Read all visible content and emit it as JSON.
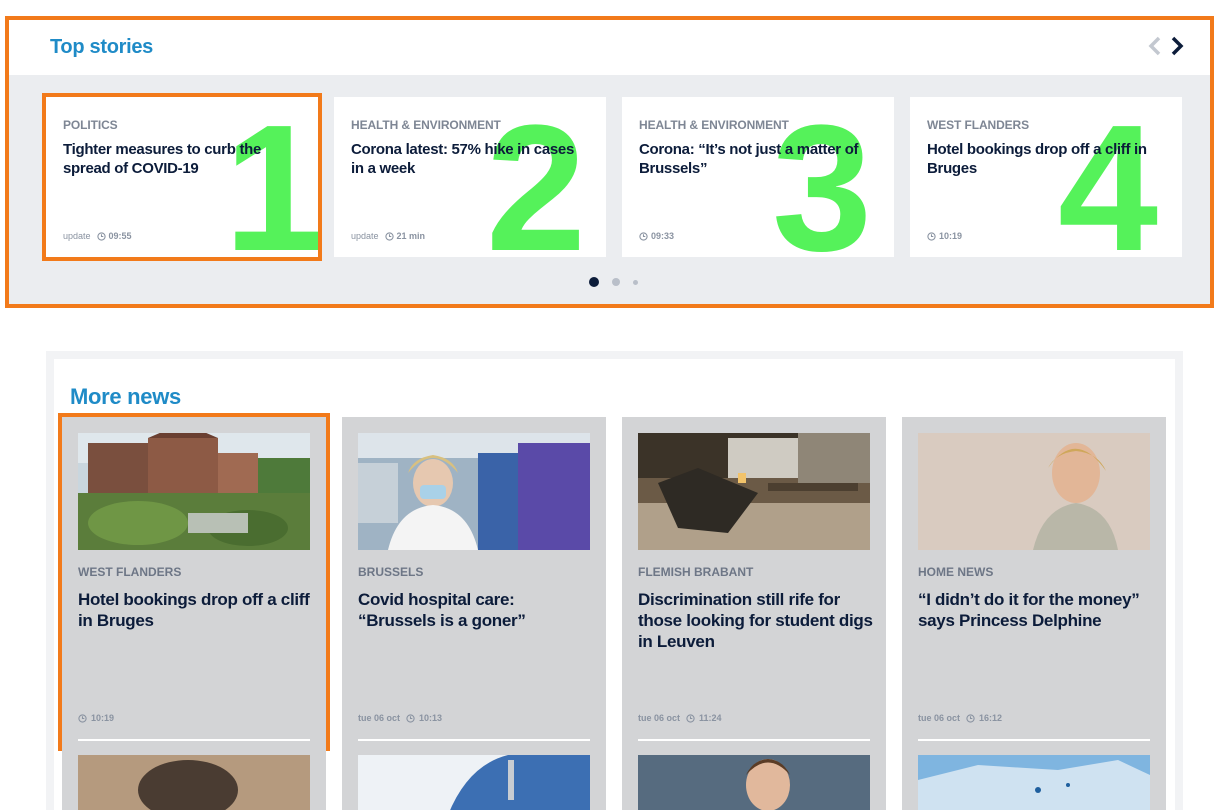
{
  "top_stories": {
    "title": "Top stories",
    "stories": [
      {
        "category": "POLITICS",
        "headline": "Tighter measures to curb the spread of COVID-19",
        "update": "update",
        "time": "09:55",
        "number": "1"
      },
      {
        "category": "HEALTH & ENVIRONMENT",
        "headline": "Corona latest: 57% hike in cases in a week",
        "update": "update",
        "time": "21 min",
        "number": "2"
      },
      {
        "category": "HEALTH & ENVIRONMENT",
        "headline": "Corona: “It’s not just a matter of Brussels”",
        "update": "",
        "time": "09:33",
        "number": "3"
      },
      {
        "category": "WEST FLANDERS",
        "headline": "Hotel bookings drop off a cliff in Bruges",
        "update": "",
        "time": "10:19",
        "number": "4"
      }
    ],
    "nav": {
      "prev_icon": "chevron-left-icon",
      "next_icon": "chevron-right-icon"
    },
    "pagination": {
      "active": 1,
      "total": 3
    }
  },
  "more_news": {
    "title": "More news",
    "cards": [
      {
        "category": "WEST FLANDERS",
        "headline": "Hotel bookings drop off a cliff in Bruges",
        "date": "",
        "time": "10:19"
      },
      {
        "category": "BRUSSELS",
        "headline": "Covid hospital care: “Brussels is a goner”",
        "date": "tue 06 oct",
        "time": "10:13"
      },
      {
        "category": "FLEMISH BRABANT",
        "headline": "Discrimination still rife for those looking for student digs in Leuven",
        "date": "tue 06 oct",
        "time": "11:24"
      },
      {
        "category": "HOME NEWS",
        "headline": "“I didn’t do it for the money” says Princess Delphine",
        "date": "tue 06 oct",
        "time": "16:12"
      }
    ]
  },
  "colors": {
    "accent": "#1f8bc7",
    "highlight": "#f27a1a",
    "number": "#55f25a",
    "text": "#0c1c3a"
  }
}
